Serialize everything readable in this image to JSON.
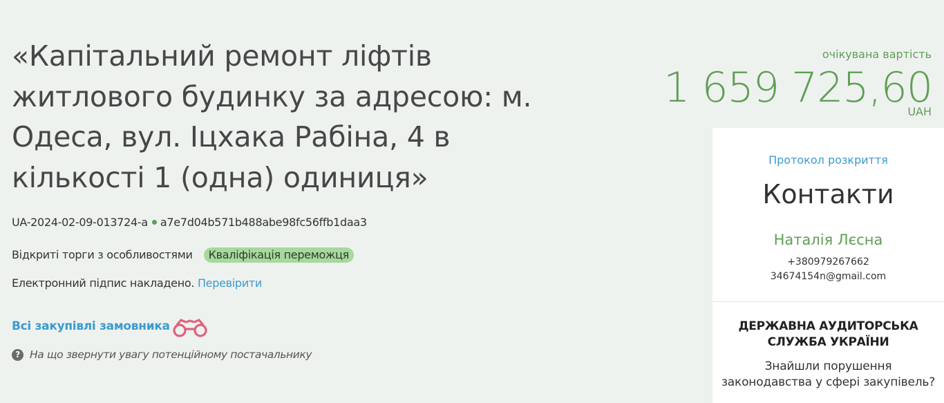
{
  "tender": {
    "title": "«Капітальний ремонт ліфтів житлового будинку за адресою: м. Одеса, вул. Іцхака Рабіна, 4 в кількості 1 (одна) одиниця»",
    "id": "UA-2024-02-09-013724-a",
    "hash": "a7e7d04b571b488abe98fc56ffb1daa3",
    "procedure_type": "Відкриті торги з особливостями",
    "status_badge": "Кваліфікація переможця",
    "signature_text": "Електронний підпис накладено.",
    "verify_link": "Перевірити",
    "all_purchases_link": "Всі закупівлі замовника",
    "hint_text": "На що звернути увагу потенційному постачальнику",
    "hint_icon": "?"
  },
  "price": {
    "label": "очікувана вартість",
    "amount": "1 659 725,60",
    "currency": "UAH"
  },
  "panel": {
    "protocol_link": "Протокол розкриття",
    "contacts_title": "Контакти",
    "contact_name": "Наталія Лєсна",
    "contact_phone": "+380979267662",
    "contact_email": "34674154n@gmail.com",
    "audit_title_line1": "ДЕРЖАВНА АУДИТОРСЬКА",
    "audit_title_line2": "СЛУЖБА УКРАЇНИ",
    "audit_text_line1": "Знайшли порушення",
    "audit_text_line2": "законодавства у сфері закупівель?"
  },
  "colors": {
    "background": "#eef2ef",
    "accent_green": "#5f9e55",
    "link_blue": "#3b9bd0",
    "badge_green": "#a6d99b",
    "binoculars_pink": "#e0627a"
  },
  "icons": {
    "status_dot": "status-dot-icon",
    "binoculars": "binoculars-icon",
    "hint": "question-circle-icon"
  }
}
